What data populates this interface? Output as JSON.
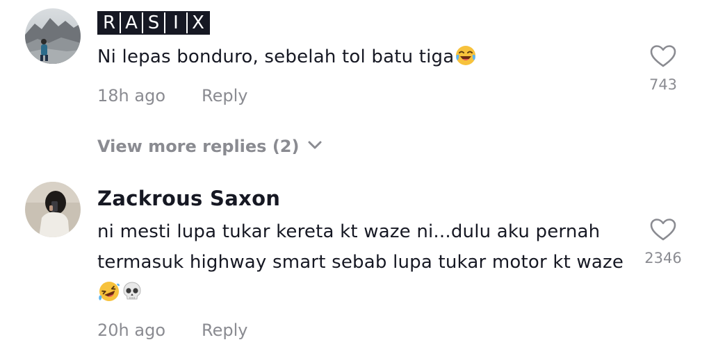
{
  "comments": [
    {
      "username": "RASIX",
      "username_letters": [
        "R",
        "A",
        "S",
        "I",
        "X"
      ],
      "text": "Ni lepas bonduro, sebelah tol batu tiga",
      "emoji": "face-with-tears-of-joy-icon",
      "time": "18h ago",
      "reply_label": "Reply",
      "likes": "743"
    },
    {
      "username": "Zackrous Saxon",
      "text": "ni mesti lupa tukar kereta kt waze ni...dulu aku pernah termasuk highway smart sebab lupa tukar motor kt waze",
      "emoji": [
        "rolling-on-floor-laughing-icon",
        "skull-icon"
      ],
      "time": "20h ago",
      "reply_label": "Reply",
      "likes": "2346"
    }
  ],
  "view_more_replies": "View more replies (2)",
  "colors": {
    "primary_text": "#161823",
    "secondary_text": "#8a8b91",
    "background": "#ffffff"
  }
}
